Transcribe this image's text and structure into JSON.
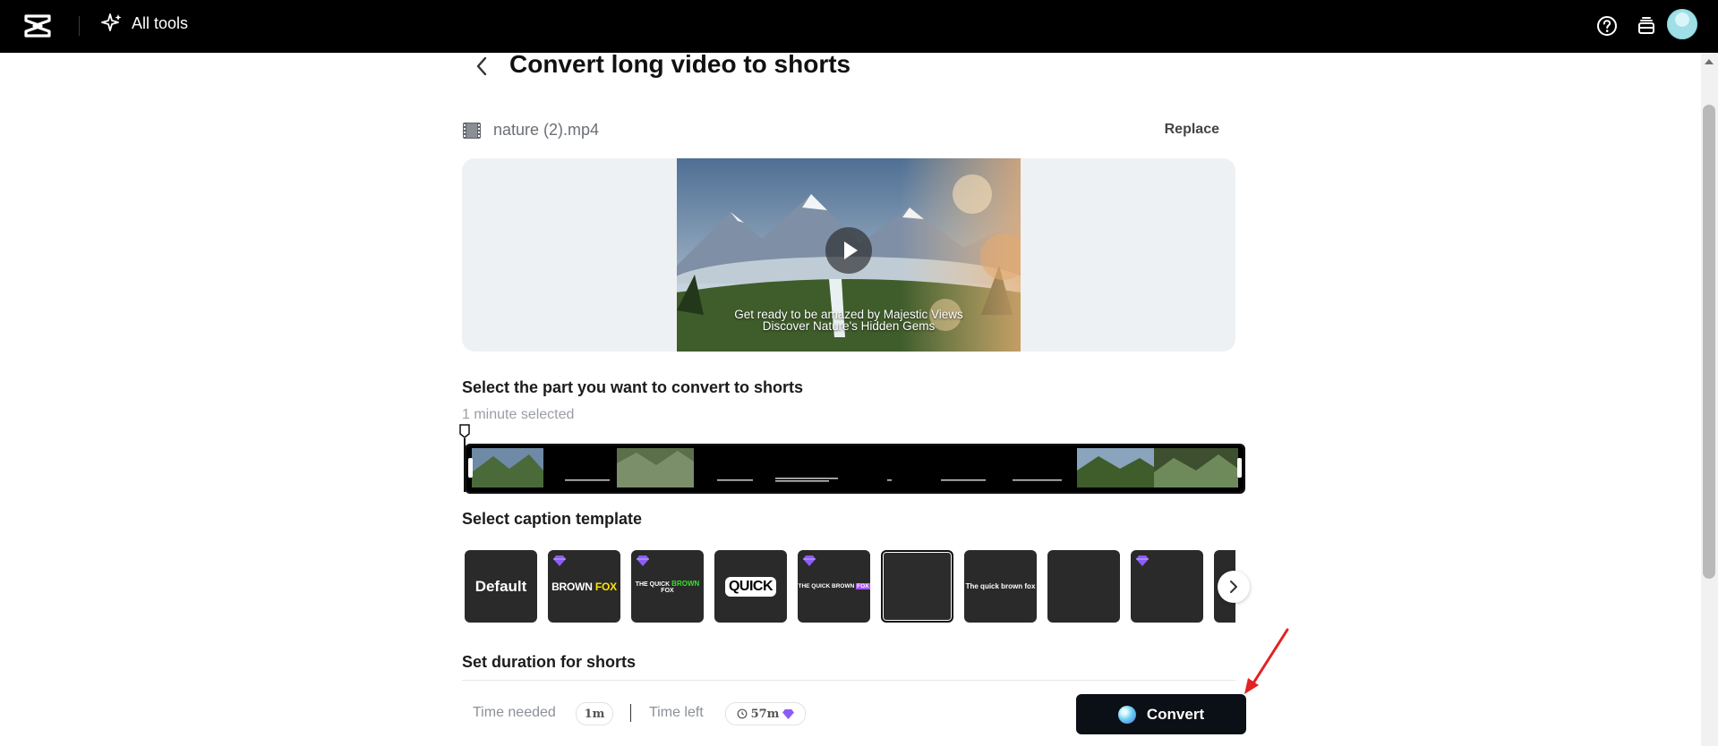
{
  "topbar": {
    "all_tools_label": "All tools"
  },
  "header": {
    "title": "Convert long video to shorts"
  },
  "file": {
    "name": "nature (2).mp4",
    "replace_label": "Replace"
  },
  "preview": {
    "caption_line1": "Get ready to be amazed by Majestic Views",
    "caption_line2": "Discover Nature's Hidden Gems"
  },
  "select_part": {
    "heading": "Select the part you want to convert to shorts",
    "selected_text": "1 minute selected"
  },
  "caption_template": {
    "heading": "Select caption template",
    "templates": [
      {
        "label": "Default",
        "premium": false
      },
      {
        "label": "BROWN FOX",
        "premium": true
      },
      {
        "label": "THE QUICK BROWN FOX",
        "premium": true
      },
      {
        "label": "QUICK",
        "premium": false
      },
      {
        "label": "THE QUICK BROWN FOX",
        "premium": true
      },
      {
        "label": "",
        "premium": false
      },
      {
        "label": "The quick brown fox",
        "premium": false
      },
      {
        "label": "",
        "premium": false
      },
      {
        "label": "",
        "premium": true
      },
      {
        "label": "",
        "premium": false
      }
    ],
    "selected_index": 5
  },
  "duration": {
    "heading": "Set duration for shorts"
  },
  "footer": {
    "time_needed_label": "Time needed",
    "time_needed_value": "1m",
    "time_left_label": "Time left",
    "time_left_value": "57m",
    "convert_label": "Convert"
  },
  "colors": {
    "topbar_bg": "#000000",
    "convert_bg": "#0b0f16",
    "premium_gem": "#8b5cf6",
    "annotation_arrow": "#e32222",
    "highlight_green": "#36e02a",
    "highlight_yellow": "#ffe500"
  },
  "icons": [
    "capcut-logo-icon",
    "sparkle-icon",
    "help-icon",
    "layers-icon",
    "avatar",
    "back-chevron-icon",
    "film-icon",
    "play-icon",
    "gem-icon",
    "chevron-right-icon",
    "clock-icon",
    "scroll-up-icon"
  ]
}
